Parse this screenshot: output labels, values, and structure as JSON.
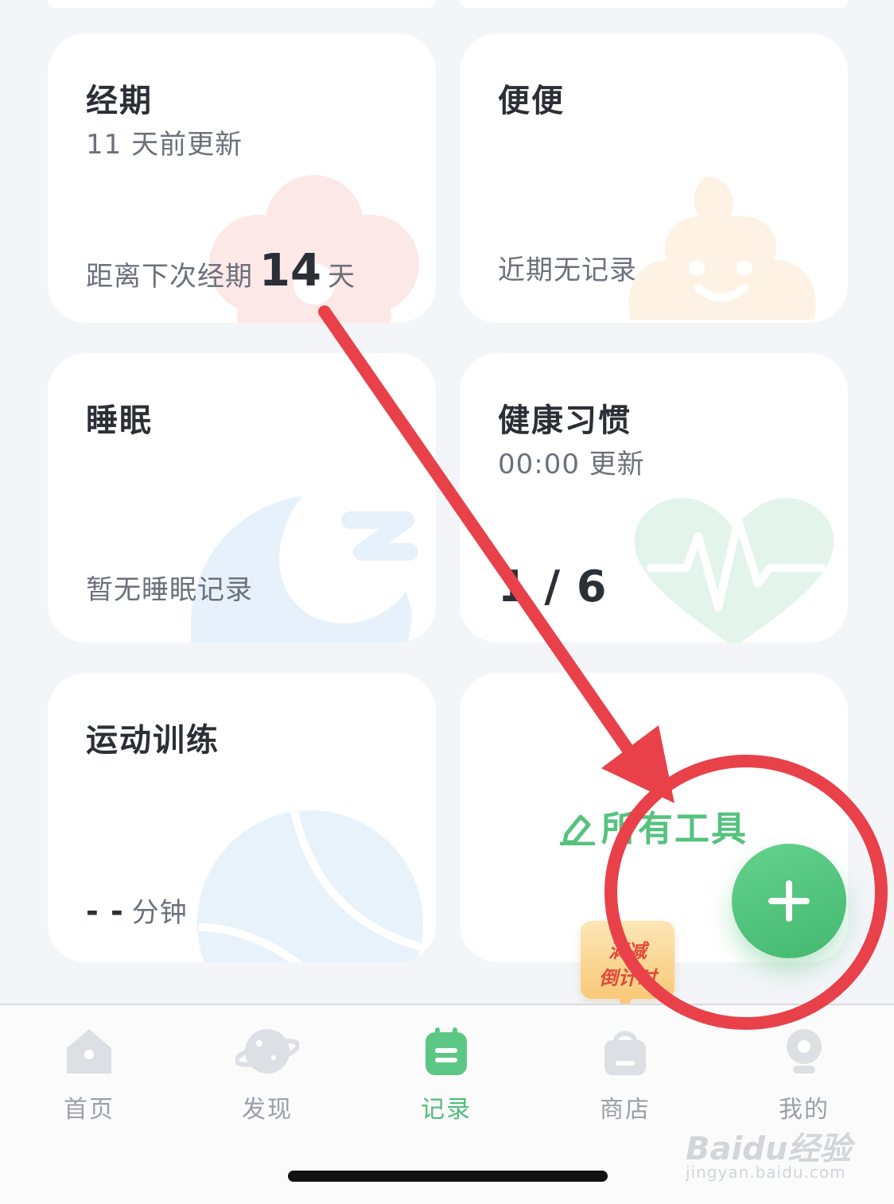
{
  "cards": {
    "period": {
      "title": "经期",
      "subtitle": "11 天前更新",
      "foot_prefix": "距离下次经期",
      "days": "14",
      "foot_suffix": "天"
    },
    "poop": {
      "title": "便便",
      "foot": "近期无记录"
    },
    "sleep": {
      "title": "睡眠",
      "foot": "暂无睡眠记录"
    },
    "habit": {
      "title": "健康习惯",
      "subtitle": "00:00 更新",
      "progress": "1 / 6"
    },
    "exercise": {
      "title": "运动训练",
      "dashes": "- -",
      "unit": "分钟"
    },
    "tools": {
      "label": "所有工具"
    }
  },
  "badge": {
    "line1": "满减",
    "line2": "倒计时"
  },
  "tabs": [
    {
      "label": "首页",
      "icon": "home-icon"
    },
    {
      "label": "发现",
      "icon": "planet-icon"
    },
    {
      "label": "记录",
      "icon": "calendar-icon"
    },
    {
      "label": "商店",
      "icon": "bag-icon"
    },
    {
      "label": "我的",
      "icon": "profile-icon"
    }
  ],
  "watermark": {
    "brand": "Baidu经验",
    "url": "jingyan.baidu.com"
  },
  "colors": {
    "accent": "#4fbe7a",
    "annotation": "#e8414a"
  }
}
